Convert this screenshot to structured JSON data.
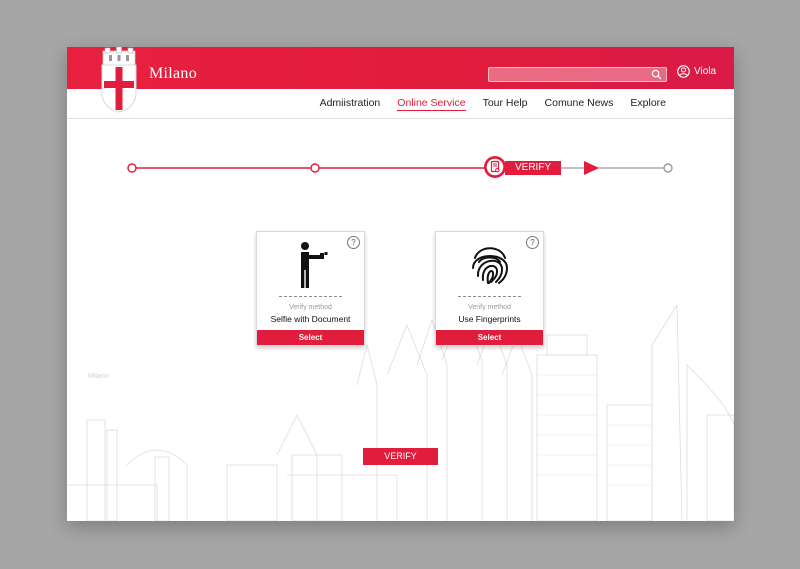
{
  "header": {
    "brand": "Milano",
    "search": {
      "value": "",
      "placeholder": ""
    },
    "user_name": "Viola"
  },
  "nav": {
    "items": [
      {
        "label": "Admiistration"
      },
      {
        "label": "Online Service",
        "active": true
      },
      {
        "label": "Tour Help"
      },
      {
        "label": "Comune News"
      },
      {
        "label": "Explore"
      }
    ]
  },
  "stepper": {
    "current_label": "VERIFY",
    "steps_total": 4,
    "current_step": 3
  },
  "methods": [
    {
      "caption": "Verify method",
      "title": "Selfie with Document",
      "button": "Select",
      "help": "?"
    },
    {
      "caption": "Verify method",
      "title": "Use Fingerprints",
      "button": "Select",
      "help": "?"
    }
  ],
  "background_label": "Milano",
  "verify_button": "VERIFY",
  "colors": {
    "accent": "#e21c3c",
    "background": "#a6a6a6"
  }
}
